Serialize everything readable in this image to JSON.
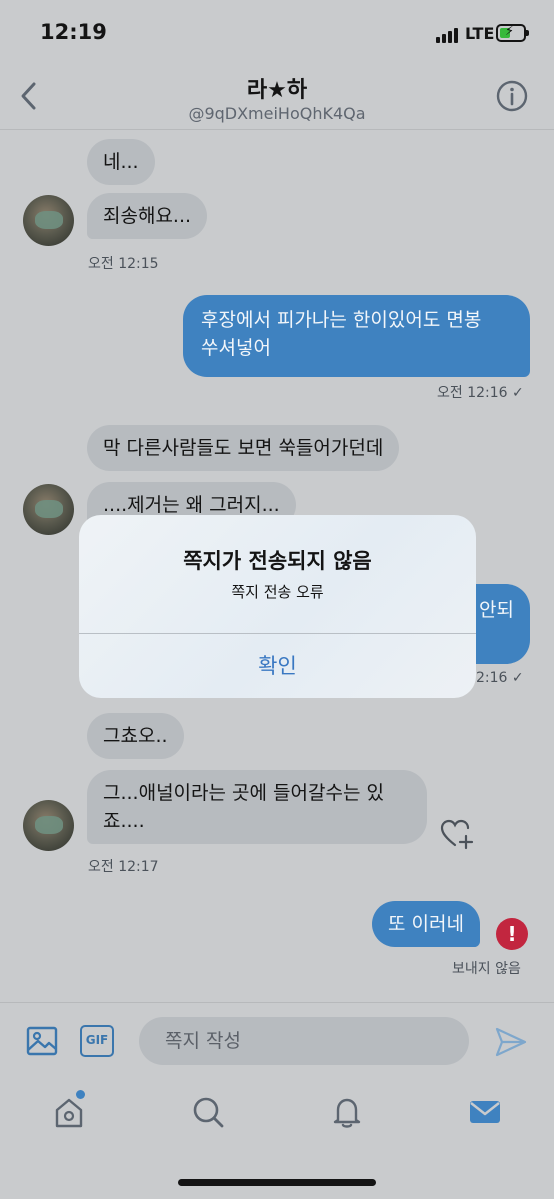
{
  "status_bar": {
    "time": "12:19",
    "network": "LTE"
  },
  "header": {
    "title": "라★하",
    "handle": "@9qDXmeiHoQhK4Qa"
  },
  "messages": [
    {
      "text": "네..."
    },
    {
      "text": "죄송해요..."
    },
    {
      "meta": "오전 12:15"
    },
    {
      "line1": "후장에서 피가나는 한이있어도 면봉",
      "line2": "쑤셔넣어"
    },
    {
      "meta": "오전 12:16 ✓"
    },
    {
      "text": "막 다른사람들도 보면 쑥들어가던데"
    },
    {
      "text": "....제거는 왜 그러지..."
    },
    {
      "partial": "안되"
    },
    {
      "meta": "2:16 ✓"
    },
    {
      "text": "그쵸오.."
    },
    {
      "line1": "그...애널이라는 곳에 들어갈수는 있",
      "line2": "죠...."
    },
    {
      "meta": "오전 12:17"
    },
    {
      "text": "또 이러네"
    },
    {
      "meta": "보내지 않음"
    }
  ],
  "compose": {
    "placeholder": "쪽지 작성",
    "gif_label": "GIF"
  },
  "alert": {
    "title": "쪽지가 전송되지 않음",
    "message": "쪽지 전송 오류",
    "button": "확인"
  },
  "icons": {
    "back": "chevron-left-icon",
    "info": "info-icon",
    "heart": "heart-plus-icon",
    "error": "exclamation-icon",
    "image": "image-icon",
    "send": "send-icon",
    "home": "home-icon",
    "search": "search-icon",
    "notifications": "bell-icon",
    "messages": "mail-icon"
  },
  "colors": {
    "accent": "#3f82c0",
    "error": "#c2263f",
    "battery": "#36b93a"
  }
}
